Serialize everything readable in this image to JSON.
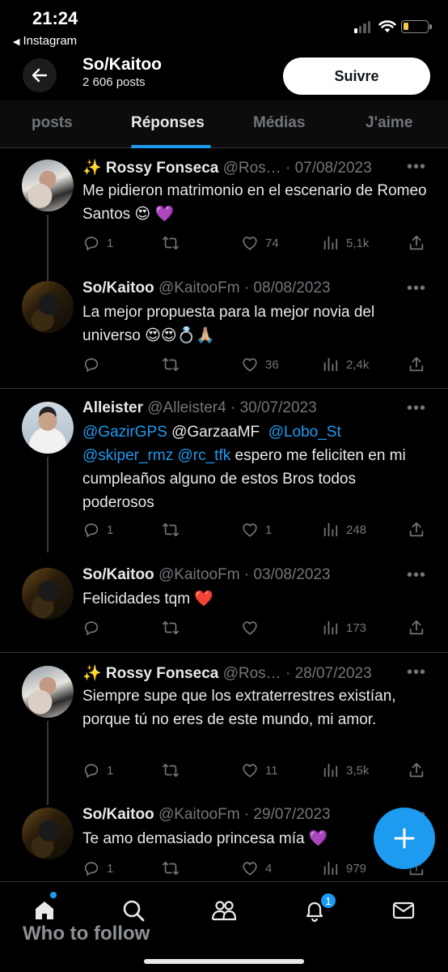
{
  "status_bar": {
    "time": "21:24",
    "back_app": "Instagram"
  },
  "header": {
    "title": "So/Kaitoo",
    "posts_count": "2 606 posts",
    "follow_label": "Suivre"
  },
  "tabs": [
    "posts",
    "Réponses",
    "Médias",
    "J'aime"
  ],
  "active_tab": "Réponses",
  "tweets": [
    {
      "name": "✨ Rossy Fonseca",
      "handle": "@Ros… · 07/08/2023",
      "text": "Me pidieron matrimonio en el escenario de Romeo Santos  😍 💜",
      "replies": "1",
      "retweets": "",
      "likes": "74",
      "views": "5,1k"
    },
    {
      "name": "So/Kaitoo",
      "handle": "@KaitooFm · 08/08/2023",
      "text": "La mejor propuesta para la mejor novia del universo 😍😍💍🙏🏼",
      "replies": "",
      "retweets": "",
      "likes": "36",
      "views": "2,4k"
    },
    {
      "name": "Alleister",
      "handle": "@Alleister4 · 30/07/2023",
      "mentions": [
        "@GazirGPS",
        "@GarzaaMF",
        "@Lobo_St",
        "@skiper_rmz",
        "@rc_tfk"
      ],
      "text_tail": " espero me feliciten en mi cumpleaños alguno de estos Bros todos poderosos",
      "replies": "1",
      "retweets": "",
      "likes": "1",
      "views": "248"
    },
    {
      "name": "So/Kaitoo",
      "handle": "@KaitooFm · 03/08/2023",
      "text": "Felicidades tqm ❤️",
      "replies": "",
      "retweets": "",
      "likes": "",
      "views": "173"
    },
    {
      "name": "✨ Rossy Fonseca",
      "handle": "@Ros… · 28/07/2023",
      "text": "Siempre supe que los extraterrestres existían, porque tú no eres de este mundo, mi amor.",
      "replies": "1",
      "retweets": "",
      "likes": "11",
      "views": "3,5k"
    },
    {
      "name": "So/Kaitoo",
      "handle": "@KaitooFm · 29/07/2023",
      "text": "Te amo demasiado princesa mía 💜",
      "replies": "1",
      "retweets": "",
      "likes": "4",
      "views": "979"
    }
  ],
  "bottom_nav": {
    "notifications_badge": "1",
    "overlay_text": "Who to follow"
  },
  "colors": {
    "accent": "#1d9bf0",
    "background": "#000000",
    "muted": "#71767b"
  }
}
